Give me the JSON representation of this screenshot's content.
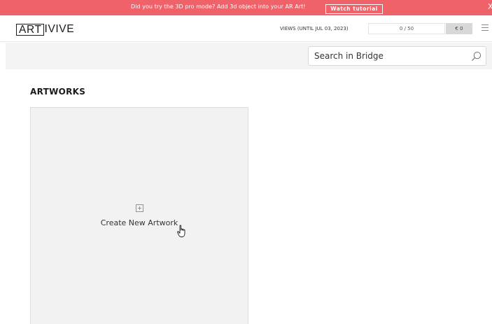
{
  "promo": {
    "text": "Did you try the 3D pro mode? Add 3d object into your AR Art!",
    "button_label": "Watch tutorial",
    "close_glyph": "X"
  },
  "header": {
    "logo_boxed": "ART",
    "logo_rest": "IVIVE",
    "views_label": "VIEWS (UNTIL JUL 03, 2023)",
    "views_count": "0 / 50",
    "balance": "€ 0",
    "menu_icon": "hamburger-menu-icon"
  },
  "search": {
    "placeholder": "Search in Bridge",
    "icon": "search-icon"
  },
  "main": {
    "section_title": "ARTWORKS",
    "create_label": "Create New Artwork",
    "create_icon": "plus-square-icon"
  },
  "colors": {
    "promo_bg": "#f0626a",
    "card_bg": "#f2f2f2",
    "strip_bg": "#f4f4f4"
  }
}
